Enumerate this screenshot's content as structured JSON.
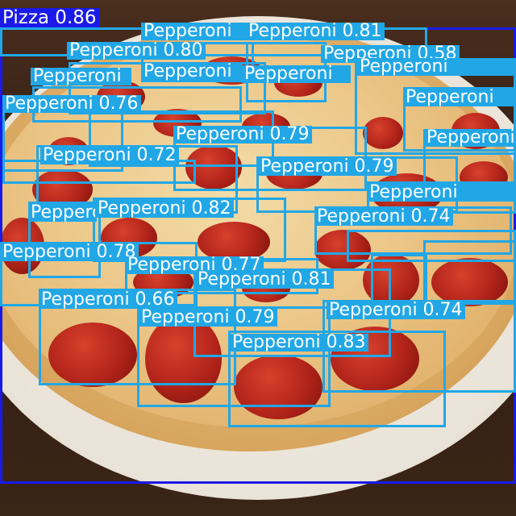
{
  "colors": {
    "pepperoni_box": "#22a7e6",
    "pizza_box": "#1a1ae8",
    "label_text": "#ffffff"
  },
  "detections": [
    {
      "name": "pizza-detection",
      "label": "Pizza 0.86"
    },
    {
      "name": "pepperoni-detection-1",
      "label": "Pepperoni 0.81"
    },
    {
      "name": "pepperoni-detection-2",
      "label": "Pepperoni 0.80"
    },
    {
      "name": "pepperoni-detection-3",
      "label": "Pepperoni 0.58"
    },
    {
      "name": "pepperoni-detection-4",
      "label": "Pepperoni 0.76"
    },
    {
      "name": "pepperoni-detection-5",
      "label": "Pepperoni 0.79"
    },
    {
      "name": "pepperoni-detection-6",
      "label": "Pepperoni 0.72"
    },
    {
      "name": "pepperoni-detection-7",
      "label": "Pepperoni 0.79"
    },
    {
      "name": "pepperoni-detection-8",
      "label": "Pepperoni 0.82"
    },
    {
      "name": "pepperoni-detection-9",
      "label": "Pepperoni 0.74"
    },
    {
      "name": "pepperoni-detection-10",
      "label": "Pepperoni 0.78"
    },
    {
      "name": "pepperoni-detection-11",
      "label": "Pepperoni 0.77"
    },
    {
      "name": "pepperoni-detection-12",
      "label": "Pepperoni 0.81"
    },
    {
      "name": "pepperoni-detection-13",
      "label": "Pepperoni 0.66"
    },
    {
      "name": "pepperoni-detection-14",
      "label": "Pepperoni 0.79"
    },
    {
      "name": "pepperoni-detection-15",
      "label": "Pepperoni 0.74"
    },
    {
      "name": "pepperoni-detection-16",
      "label": "Pepperoni 0.83"
    },
    {
      "name": "pepperoni-detection-17",
      "label": "Pepperoni"
    },
    {
      "name": "pepperoni-detection-18",
      "label": "Pepperoni"
    },
    {
      "name": "pepperoni-detection-19",
      "label": "Pepperoni"
    },
    {
      "name": "pepperoni-detection-20",
      "label": "Pepperoni"
    },
    {
      "name": "pepperoni-detection-21",
      "label": "Pepperoni"
    },
    {
      "name": "pepperoni-detection-22",
      "label": "Pepperoni"
    },
    {
      "name": "pepperoni-detection-23",
      "label": "Pepperoni"
    },
    {
      "name": "pepperoni-detection-24",
      "label": "Pepperoni"
    },
    {
      "name": "pepperoni-detection-25",
      "label": "Pepperoni"
    }
  ]
}
